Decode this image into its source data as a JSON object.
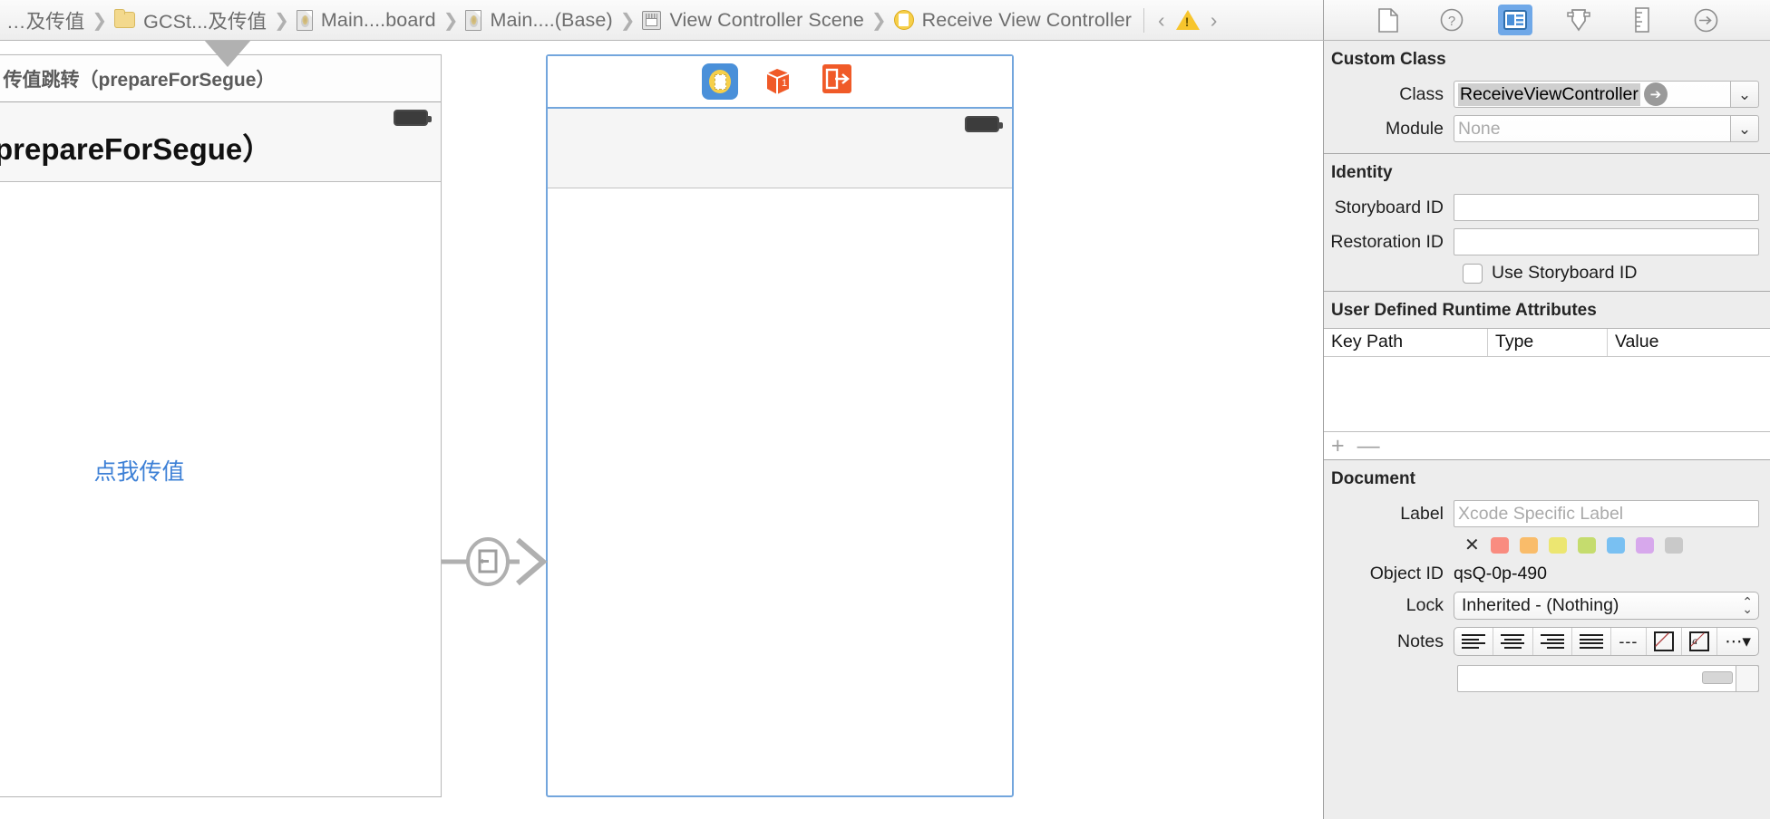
{
  "breadcrumb": {
    "items": [
      {
        "icon": "none",
        "label": "…及传值"
      },
      {
        "icon": "folder-icon",
        "label": "GCSt...及传值"
      },
      {
        "icon": "file-icon",
        "label": "Main....board"
      },
      {
        "icon": "file-icon",
        "label": "Main....(Base)"
      },
      {
        "icon": "scene-icon",
        "label": "View Controller Scene"
      },
      {
        "icon": "view-controller-icon",
        "label": "Receive View Controller"
      }
    ],
    "nav": {
      "previous": "‹",
      "next": "›",
      "warning_icon": "warning-triangle-icon"
    }
  },
  "inspector_toolbar": {
    "buttons": [
      {
        "name": "file-inspector",
        "icon": "document-icon",
        "active": false
      },
      {
        "name": "quick-help",
        "icon": "question-circle-icon",
        "active": false
      },
      {
        "name": "identity-inspector",
        "icon": "identity-card-icon",
        "active": true
      },
      {
        "name": "attributes-inspector",
        "icon": "slider-shield-icon",
        "active": false
      },
      {
        "name": "size-inspector",
        "icon": "ruler-icon",
        "active": false
      },
      {
        "name": "connections-inspector",
        "icon": "arrow-circle-icon",
        "active": false
      }
    ]
  },
  "canvas": {
    "scene_left": {
      "title": "传值跳转（prepareForSegue）",
      "navbar_title": "传值跳转（prepareForSegue）",
      "button_label": "点我传值",
      "battery_icon": "battery-icon"
    },
    "scene_right": {
      "selected": true,
      "dock_icons": [
        {
          "name": "view-controller-dock-icon",
          "selected": true
        },
        {
          "name": "first-responder-dock-icon",
          "selected": false
        },
        {
          "name": "exit-dock-icon",
          "selected": false
        }
      ],
      "battery_icon": "battery-icon"
    },
    "segue": {
      "icon": "segue-show-icon"
    }
  },
  "inspector": {
    "custom_class": {
      "header": "Custom Class",
      "class_label": "Class",
      "class_value": "ReceiveViewController",
      "module_label": "Module",
      "module_placeholder": "None"
    },
    "identity": {
      "header": "Identity",
      "storyboard_id_label": "Storyboard ID",
      "storyboard_id_value": "",
      "restoration_id_label": "Restoration ID",
      "restoration_id_value": "",
      "use_storyboard_id_label": "Use Storyboard ID",
      "use_storyboard_id_checked": false
    },
    "runtime_attributes": {
      "header": "User Defined Runtime Attributes",
      "columns": [
        "Key Path",
        "Type",
        "Value"
      ],
      "rows": [],
      "add_label": "+",
      "remove_label": "—"
    },
    "document": {
      "header": "Document",
      "label_label": "Label",
      "label_placeholder": "Xcode Specific Label",
      "color_clear_icon": "✕",
      "colors": [
        "#f98c80",
        "#f9bc6a",
        "#ece671",
        "#c5dc6e",
        "#79c0f2",
        "#d7a8ec",
        "#c9c9c9"
      ],
      "object_id_label": "Object ID",
      "object_id_value": "qsQ-0p-490",
      "lock_label": "Lock",
      "lock_value": "Inherited - (Nothing)",
      "notes_label": "Notes",
      "notes_buttons": [
        "align-left-icon",
        "align-center-icon",
        "align-right-icon",
        "align-justify-icon",
        "dashes-icon",
        "image-icon",
        "text-style-icon",
        "more-icon"
      ]
    }
  }
}
